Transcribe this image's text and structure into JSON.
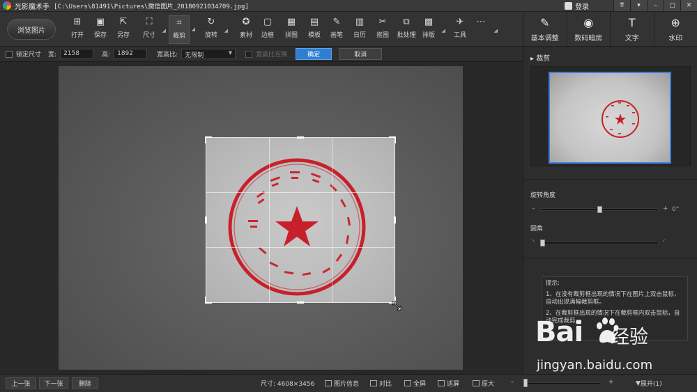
{
  "window": {
    "app_name": "光影魔术手",
    "file_path": "[C:\\Users\\81491\\Pictures\\微信图片_20180921034709.jpg]",
    "login": "登录"
  },
  "toolbar": {
    "browse": "浏览图片",
    "tools": [
      {
        "label": "打开",
        "icon": "⊞"
      },
      {
        "label": "保存",
        "icon": "▣"
      },
      {
        "label": "另存",
        "icon": "⇱"
      },
      {
        "label": "尺寸",
        "icon": "⛶"
      },
      {
        "label": "裁剪",
        "icon": "⌗"
      },
      {
        "label": "旋转",
        "icon": "↻"
      },
      {
        "label": "素材",
        "icon": "✪"
      },
      {
        "label": "边框",
        "icon": "▢"
      },
      {
        "label": "拼图",
        "icon": "▦"
      },
      {
        "label": "模板",
        "icon": "▤"
      },
      {
        "label": "画笔",
        "icon": "✎"
      },
      {
        "label": "日历",
        "icon": "▥"
      },
      {
        "label": "抠图",
        "icon": "✂"
      },
      {
        "label": "批处理",
        "icon": "⧉"
      },
      {
        "label": "排版",
        "icon": "▩"
      },
      {
        "label": "工具",
        "icon": "✈"
      },
      {
        "label": "",
        "icon": "⋯"
      }
    ]
  },
  "right_tabs": [
    {
      "label": "基本调整",
      "icon": "✎"
    },
    {
      "label": "数码暗房",
      "icon": "◉"
    },
    {
      "label": "文字",
      "icon": "T"
    },
    {
      "label": "水印",
      "icon": "⊕"
    }
  ],
  "options": {
    "lock_size": "锁定尺寸",
    "width_label": "宽:",
    "width_value": "2158",
    "height_label": "高:",
    "height_value": "1892",
    "ratio_label": "宽高比:",
    "ratio_value": "无限制",
    "swap_ratio": "宽高比互换",
    "ok": "确定",
    "cancel": "取消"
  },
  "panel": {
    "crop_title": "裁剪",
    "rotate_label": "旋转角度",
    "rotate_value": 0,
    "rotate_unit": "0°",
    "corner_label": "圆角",
    "corner_value": 0,
    "tips_title": "提示:",
    "tip1": "1、在没有裁剪框出现的情况下在图片上双击鼠标，自动出现满幅裁剪框。",
    "tip2": "2、在裁剪框出现的情况下在裁剪框内双击鼠标，自动完成裁剪。"
  },
  "status": {
    "prev": "上一张",
    "next": "下一张",
    "delete": "删除",
    "size": "尺寸: 4608×3456",
    "info": "图片信息",
    "compare": "对比",
    "fullscreen": "全屏",
    "fit": "适屏",
    "original": "原大",
    "expand": "展开(1)"
  },
  "watermark": {
    "text": "Bai",
    "du": "du",
    "cn": "经验",
    "url": "jingyan.baidu.com"
  },
  "colors": {
    "accent": "#2f7fd1",
    "stamp_red": "#c8202a"
  }
}
